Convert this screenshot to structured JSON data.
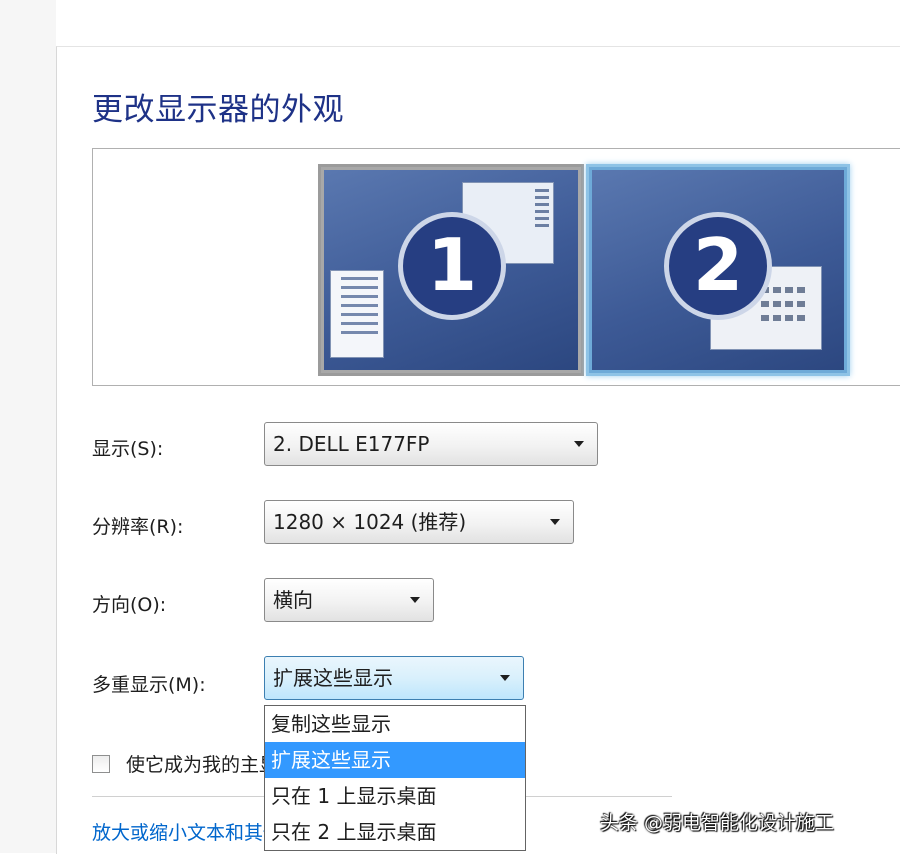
{
  "page_title": "更改显示器的外观",
  "monitors": [
    {
      "number": "1",
      "selected": false
    },
    {
      "number": "2",
      "selected": true
    }
  ],
  "fields": {
    "display": {
      "label": "显示(S):",
      "value": "2. DELL E177FP"
    },
    "resolution": {
      "label": "分辨率(R):",
      "value": "1280 × 1024 (推荐)"
    },
    "orientation": {
      "label": "方向(O):",
      "value": "横向"
    },
    "multiple_displays": {
      "label": "多重显示(M):",
      "value": "扩展这些显示"
    }
  },
  "dropdown_options": [
    "复制这些显示",
    "扩展这些显示",
    "只在 1 上显示桌面",
    "只在 2 上显示桌面"
  ],
  "dropdown_selected_index": 1,
  "checkbox": {
    "label": "使它成为我的主显示器",
    "checked": false
  },
  "link": {
    "text": "放大或缩小文本和其他项目"
  },
  "watermark": "头条 @弱电智能化设计施工",
  "colors": {
    "title": "#1e3287",
    "highlight": "#3399ff",
    "link": "#0066cc"
  }
}
